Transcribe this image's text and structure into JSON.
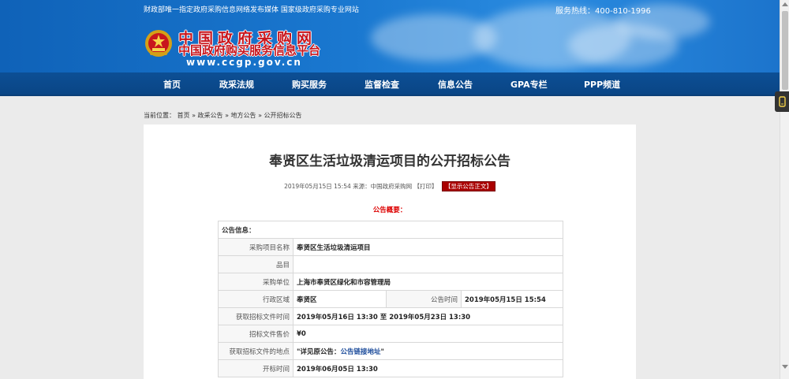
{
  "topbar": {
    "left_text": "财政部唯一指定政府采购信息网络发布媒体  国家级政府采购专业网站",
    "hotline": "服务热线：400-810-1996"
  },
  "logo": {
    "line1": "中国政府采购网",
    "line2": "中国政府购买服务信息平台",
    "url": "www.ccgp.gov.cn"
  },
  "nav": {
    "items": [
      "首页",
      "政采法规",
      "购买服务",
      "监督检查",
      "信息公告",
      "GPA专栏",
      "PPP频道"
    ]
  },
  "breadcrumb": {
    "prefix": "当前位置：",
    "items": [
      "首页",
      "政采公告",
      "地方公告",
      "公开招标公告"
    ],
    "separator": "»"
  },
  "article": {
    "title": "奉贤区生活垃圾清运项目的公开招标公告",
    "meta_text": "2019年05月15日 15:54 来源：中国政府采购网 【打印】",
    "show_original_btn": "【显示公告正文】",
    "summary_heading": "公告概要："
  },
  "info_table": {
    "section_label": "公告信息：",
    "rows": [
      {
        "label": "采购项目名称",
        "value": "奉贤区生活垃圾清运项目"
      },
      {
        "label": "品目",
        "value": ""
      },
      {
        "label": "采购单位",
        "value": "上海市奉贤区绿化和市容管理局"
      },
      {
        "label": "行政区域",
        "value": "奉贤区",
        "label2": "公告时间",
        "value2": "2019年05月15日 15:54"
      },
      {
        "label": "获取招标文件时间",
        "value": "2019年05月16日 13:30 至 2019年05月23日 13:30"
      },
      {
        "label": "招标文件售价",
        "value": "¥0"
      },
      {
        "label": "获取招标文件的地点",
        "value_prefix": "\"详见原公告：",
        "value_link": "公告链接地址",
        "value_suffix": "\""
      },
      {
        "label": "开标时间",
        "value": "2019年06月05日 13:30"
      }
    ]
  },
  "colors": {
    "header_blue": "#1a78d0",
    "nav_blue": "#0c4f95",
    "logo_red": "#c8161d",
    "summary_red": "#dd0000",
    "page_bg": "#ebebeb"
  }
}
